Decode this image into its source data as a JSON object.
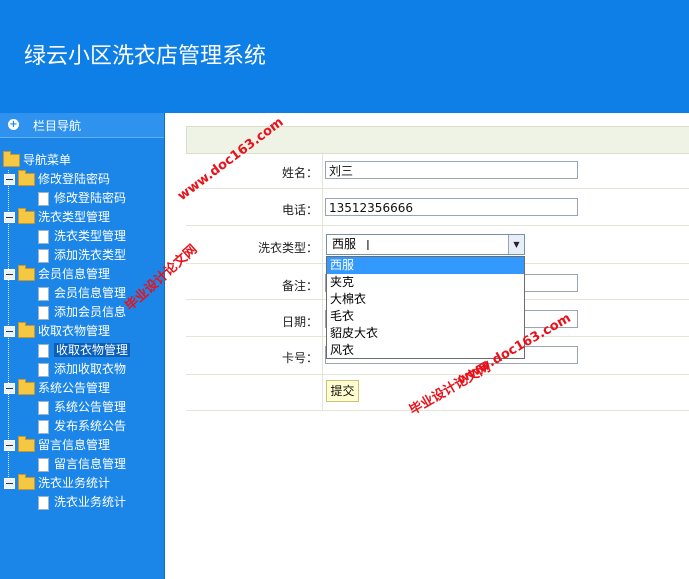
{
  "app": {
    "title": "绿云小区洗衣店管理系统"
  },
  "sidebar": {
    "header": "栏目导航",
    "root": "导航菜单",
    "groups": [
      {
        "label": "修改登陆密码",
        "items": [
          "修改登陆密码"
        ]
      },
      {
        "label": "洗衣类型管理",
        "items": [
          "洗衣类型管理",
          "添加洗衣类型"
        ]
      },
      {
        "label": "会员信息管理",
        "items": [
          "会员信息管理",
          "添加会员信息"
        ]
      },
      {
        "label": "收取衣物管理",
        "items": [
          "收取衣物管理",
          "添加收取衣物"
        ]
      },
      {
        "label": "系统公告管理",
        "items": [
          "系统公告管理",
          "发布系统公告"
        ]
      },
      {
        "label": "留言信息管理",
        "items": [
          "留言信息管理"
        ]
      },
      {
        "label": "洗衣业务统计",
        "items": [
          "洗衣业务统计"
        ]
      }
    ]
  },
  "form": {
    "name_label": "姓名：",
    "name_value": "刘三",
    "phone_label": "电话：",
    "phone_value": "13512356666",
    "type_label": "洗衣类型：",
    "type_value": "西服",
    "type_options": [
      "西服",
      "夹克",
      "大棉衣",
      "毛衣",
      "貂皮大衣",
      "风衣"
    ],
    "note_label": "备注：",
    "date_label": "日期：",
    "card_label": "卡号：",
    "submit_label": "提交"
  },
  "watermarks": {
    "site": "www.doc163.com",
    "text": "毕业设计论文网"
  },
  "colors": {
    "header_bg": "#0d7fe6",
    "sidebar_bg": "#1c86e8",
    "selected_option": "#3399ff",
    "watermark": "#e8121b"
  }
}
